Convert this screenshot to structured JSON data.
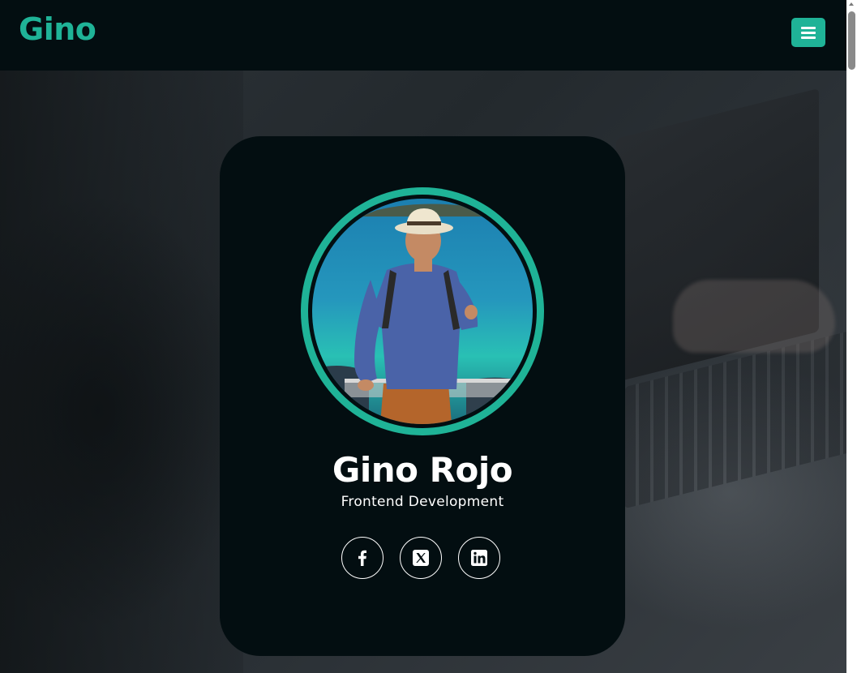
{
  "header": {
    "logo_text": "Gino",
    "menu_icon": "hamburger-menu-icon"
  },
  "profile": {
    "name": "Gino Rojo",
    "role": "Frontend Development",
    "photo": "avatar photo: man in straw hat and blue shirt in front of turquoise sea"
  },
  "socials": [
    {
      "icon": "facebook-icon"
    },
    {
      "icon": "x-twitter-icon"
    },
    {
      "icon": "linkedin-icon"
    }
  ],
  "colors": {
    "accent": "#1fb397",
    "header_bg": "#030e11",
    "card_bg": "#030e11",
    "text": "#ffffff"
  }
}
